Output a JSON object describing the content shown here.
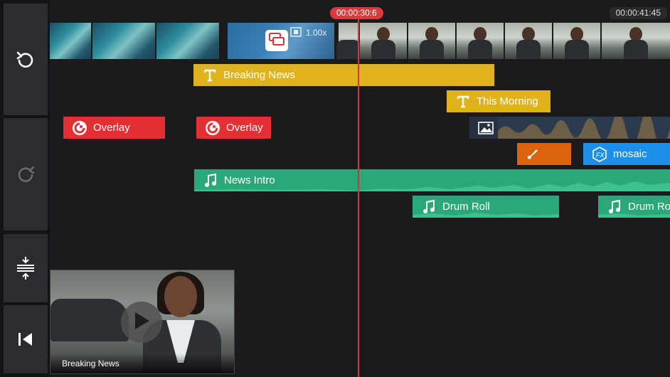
{
  "toolbar": {
    "icons": [
      "undo-icon",
      "redo-icon",
      "collapse-icon",
      "skip-to-start-icon"
    ]
  },
  "timecodes": {
    "current": "00:00:30:6",
    "total": "00:00:41:45"
  },
  "filmstrip": {
    "speed_label": "1.00x",
    "transition_icon": "transition-icon",
    "speed_icon": "film-speed-icon"
  },
  "clips": {
    "breaking_news": {
      "label": "Breaking News",
      "type": "title",
      "icon": "title-t-icon"
    },
    "this_morning": {
      "label": "This Morning",
      "type": "title",
      "icon": "title-t-icon"
    },
    "overlay_1": {
      "label": "Overlay",
      "type": "overlay",
      "icon": "overlay-icon"
    },
    "overlay_2": {
      "label": "Overlay",
      "type": "overlay",
      "icon": "overlay-icon"
    },
    "image_clip": {
      "icon": "image-icon"
    },
    "draw_clip": {
      "icon": "brush-icon"
    },
    "mosaic": {
      "label": "mosaic",
      "type": "fx",
      "icon": "fx-icon"
    },
    "news_intro": {
      "label": "News Intro",
      "type": "audio",
      "icon": "music-note-icon"
    },
    "drum_roll_1": {
      "label": "Drum Roll",
      "type": "audio",
      "icon": "music-note-icon"
    },
    "drum_roll_2": {
      "label": "Drum Ro",
      "type": "audio",
      "icon": "music-note-icon"
    }
  },
  "preview": {
    "caption": "Breaking News",
    "play_icon": "play-icon"
  },
  "colors": {
    "title": "#e0b21c",
    "overlay": "#e42f35",
    "audio": "#2ba879",
    "fx": "#1d8fe8",
    "draw": "#dc630e",
    "playhead": "#d7343a"
  }
}
